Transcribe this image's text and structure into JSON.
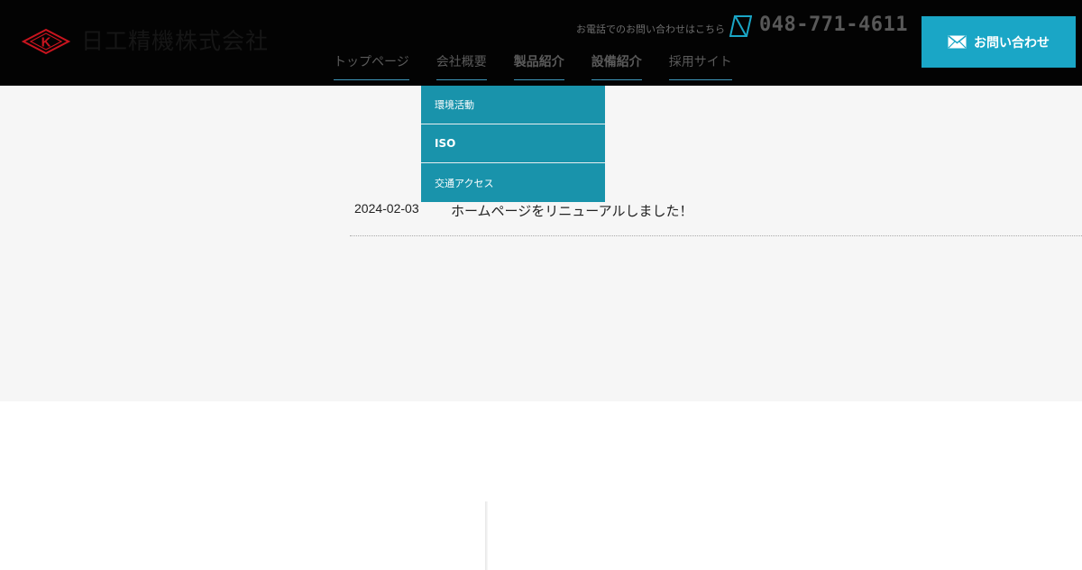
{
  "header": {
    "logo": {
      "mark_letter": "K",
      "company_name": "日工精機株式会社"
    },
    "phone": {
      "label": "お電話でのお問い合わせはこちら",
      "number": "048-771-4611"
    },
    "contact_button": {
      "label": "お問い合わせ"
    }
  },
  "nav": {
    "items": [
      {
        "label": "トップページ"
      },
      {
        "label": "会社概要"
      },
      {
        "label": "製品紹介"
      },
      {
        "label": "設備紹介"
      },
      {
        "label": "採用サイト"
      }
    ]
  },
  "dropdown": {
    "items": [
      {
        "label": "環境活動"
      },
      {
        "label": "ISO"
      },
      {
        "label": "交通アクセス"
      }
    ]
  },
  "news": {
    "items": [
      {
        "date": "2024-02-03",
        "title": "ホームページをリニューアルしました！"
      }
    ]
  },
  "colors": {
    "header_bg": "#030303",
    "accent": "#1aa6c6",
    "dropdown_bg": "#1993ab",
    "logo_red": "#c8141e",
    "content_bg": "#f6f6f6"
  }
}
